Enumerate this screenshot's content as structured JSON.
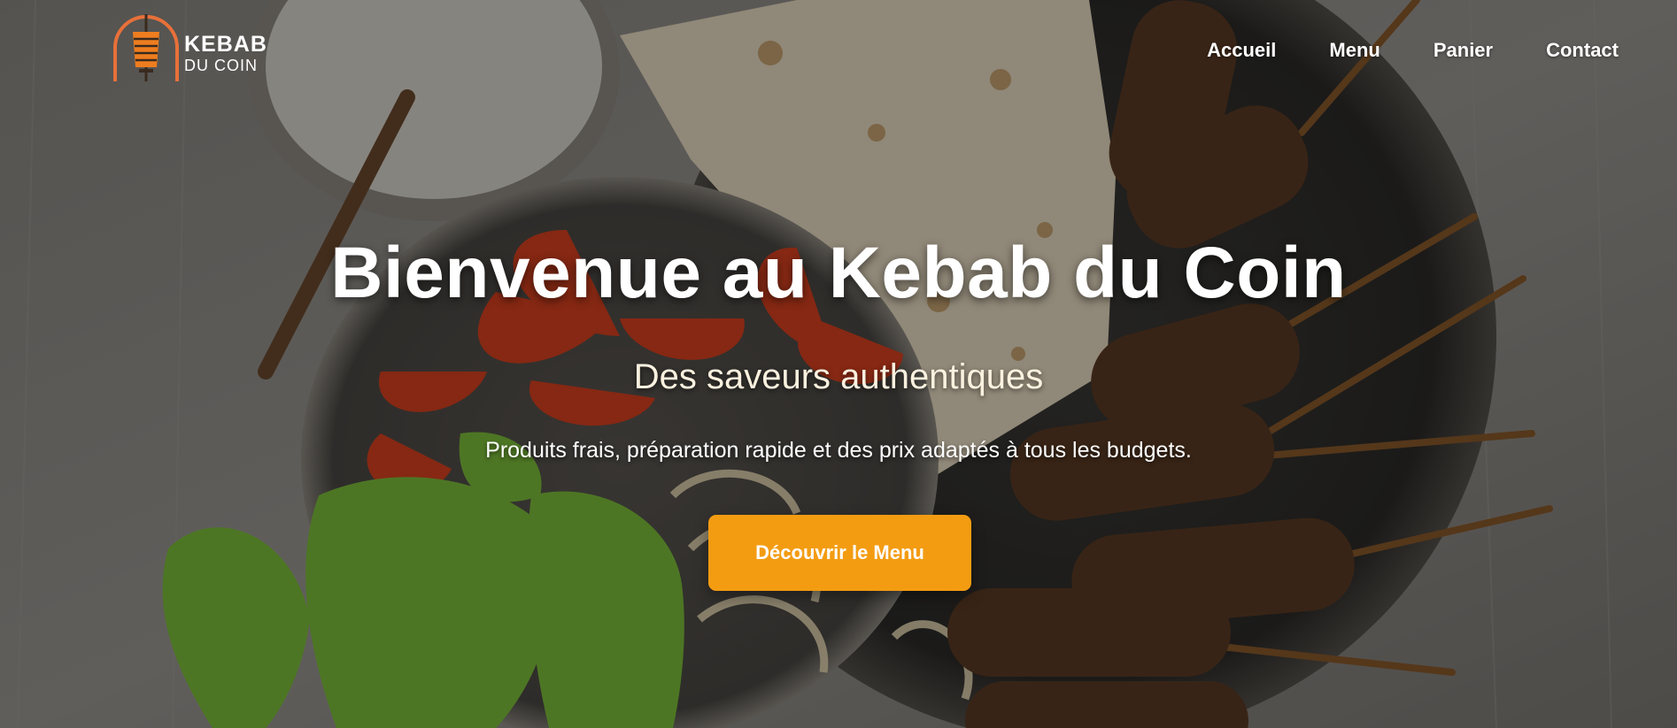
{
  "brand": {
    "name_line1": "KEBAB",
    "name_line2": "DU COIN",
    "logo_icon": "doner-kebab-icon",
    "accent_color": "#f39c12",
    "logo_arch_color": "#e8703a"
  },
  "nav": {
    "items": [
      {
        "label": "Accueil"
      },
      {
        "label": "Menu"
      },
      {
        "label": "Panier"
      },
      {
        "label": "Contact"
      }
    ]
  },
  "hero": {
    "title": "Bienvenue au Kebab du Coin",
    "subtitle": "Des saveurs authentiques",
    "tagline": "Produits frais, préparation rapide et des prix adaptés à tous les budgets.",
    "cta_label": "Découvrir le Menu",
    "background": "food-platter-photo"
  }
}
